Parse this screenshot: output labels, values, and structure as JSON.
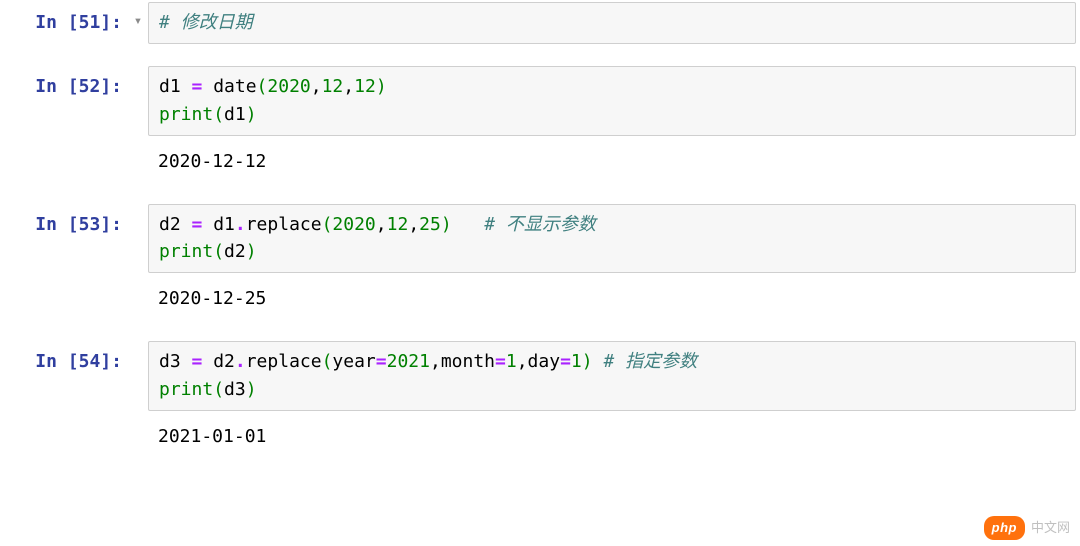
{
  "cells": [
    {
      "prompt": "In [51]:",
      "show_run_arrow": true,
      "code_tokens": [
        {
          "t": "# 修改日期",
          "cls": "tk-cmt"
        }
      ]
    },
    {
      "prompt": "In [52]:",
      "show_run_arrow": false,
      "code_tokens": [
        {
          "t": "d1 ",
          "cls": "tk-id"
        },
        {
          "t": "=",
          "cls": "tk-op"
        },
        {
          "t": " date",
          "cls": "tk-id"
        },
        {
          "t": "(",
          "cls": "tk-paren"
        },
        {
          "t": "2020",
          "cls": "tk-num"
        },
        {
          "t": ",",
          "cls": "tk-id"
        },
        {
          "t": "12",
          "cls": "tk-num"
        },
        {
          "t": ",",
          "cls": "tk-id"
        },
        {
          "t": "12",
          "cls": "tk-num"
        },
        {
          "t": ")",
          "cls": "tk-paren"
        },
        {
          "t": "\n",
          "cls": ""
        },
        {
          "t": "print",
          "cls": "tk-builtin"
        },
        {
          "t": "(",
          "cls": "tk-paren"
        },
        {
          "t": "d1",
          "cls": "tk-id"
        },
        {
          "t": ")",
          "cls": "tk-paren"
        }
      ],
      "output": "2020-12-12"
    },
    {
      "prompt": "In [53]:",
      "show_run_arrow": false,
      "code_tokens": [
        {
          "t": "d2 ",
          "cls": "tk-id"
        },
        {
          "t": "=",
          "cls": "tk-op"
        },
        {
          "t": " d1",
          "cls": "tk-id"
        },
        {
          "t": ".",
          "cls": "tk-op"
        },
        {
          "t": "replace",
          "cls": "tk-id"
        },
        {
          "t": "(",
          "cls": "tk-paren"
        },
        {
          "t": "2020",
          "cls": "tk-num"
        },
        {
          "t": ",",
          "cls": "tk-id"
        },
        {
          "t": "12",
          "cls": "tk-num"
        },
        {
          "t": ",",
          "cls": "tk-id"
        },
        {
          "t": "25",
          "cls": "tk-num"
        },
        {
          "t": ")",
          "cls": "tk-paren"
        },
        {
          "t": "   ",
          "cls": ""
        },
        {
          "t": "# 不显示参数",
          "cls": "tk-cmt"
        },
        {
          "t": "\n",
          "cls": ""
        },
        {
          "t": "print",
          "cls": "tk-builtin"
        },
        {
          "t": "(",
          "cls": "tk-paren"
        },
        {
          "t": "d2",
          "cls": "tk-id"
        },
        {
          "t": ")",
          "cls": "tk-paren"
        }
      ],
      "output": "2020-12-25"
    },
    {
      "prompt": "In [54]:",
      "show_run_arrow": false,
      "code_tokens": [
        {
          "t": "d3 ",
          "cls": "tk-id"
        },
        {
          "t": "=",
          "cls": "tk-op"
        },
        {
          "t": " d2",
          "cls": "tk-id"
        },
        {
          "t": ".",
          "cls": "tk-op"
        },
        {
          "t": "replace",
          "cls": "tk-id"
        },
        {
          "t": "(",
          "cls": "tk-paren"
        },
        {
          "t": "year",
          "cls": "tk-id"
        },
        {
          "t": "=",
          "cls": "tk-op"
        },
        {
          "t": "2021",
          "cls": "tk-num"
        },
        {
          "t": ",",
          "cls": "tk-id"
        },
        {
          "t": "month",
          "cls": "tk-id"
        },
        {
          "t": "=",
          "cls": "tk-op"
        },
        {
          "t": "1",
          "cls": "tk-num"
        },
        {
          "t": ",",
          "cls": "tk-id"
        },
        {
          "t": "day",
          "cls": "tk-id"
        },
        {
          "t": "=",
          "cls": "tk-op"
        },
        {
          "t": "1",
          "cls": "tk-num"
        },
        {
          "t": ")",
          "cls": "tk-paren"
        },
        {
          "t": " ",
          "cls": ""
        },
        {
          "t": "# 指定参数",
          "cls": "tk-cmt"
        },
        {
          "t": "\n",
          "cls": ""
        },
        {
          "t": "print",
          "cls": "tk-builtin"
        },
        {
          "t": "(",
          "cls": "tk-paren"
        },
        {
          "t": "d3",
          "cls": "tk-id"
        },
        {
          "t": ")",
          "cls": "tk-paren"
        }
      ],
      "output": "2021-01-01"
    }
  ],
  "run_arrow_glyph": "▾",
  "watermark": {
    "pill": "php",
    "text": "中文网"
  }
}
